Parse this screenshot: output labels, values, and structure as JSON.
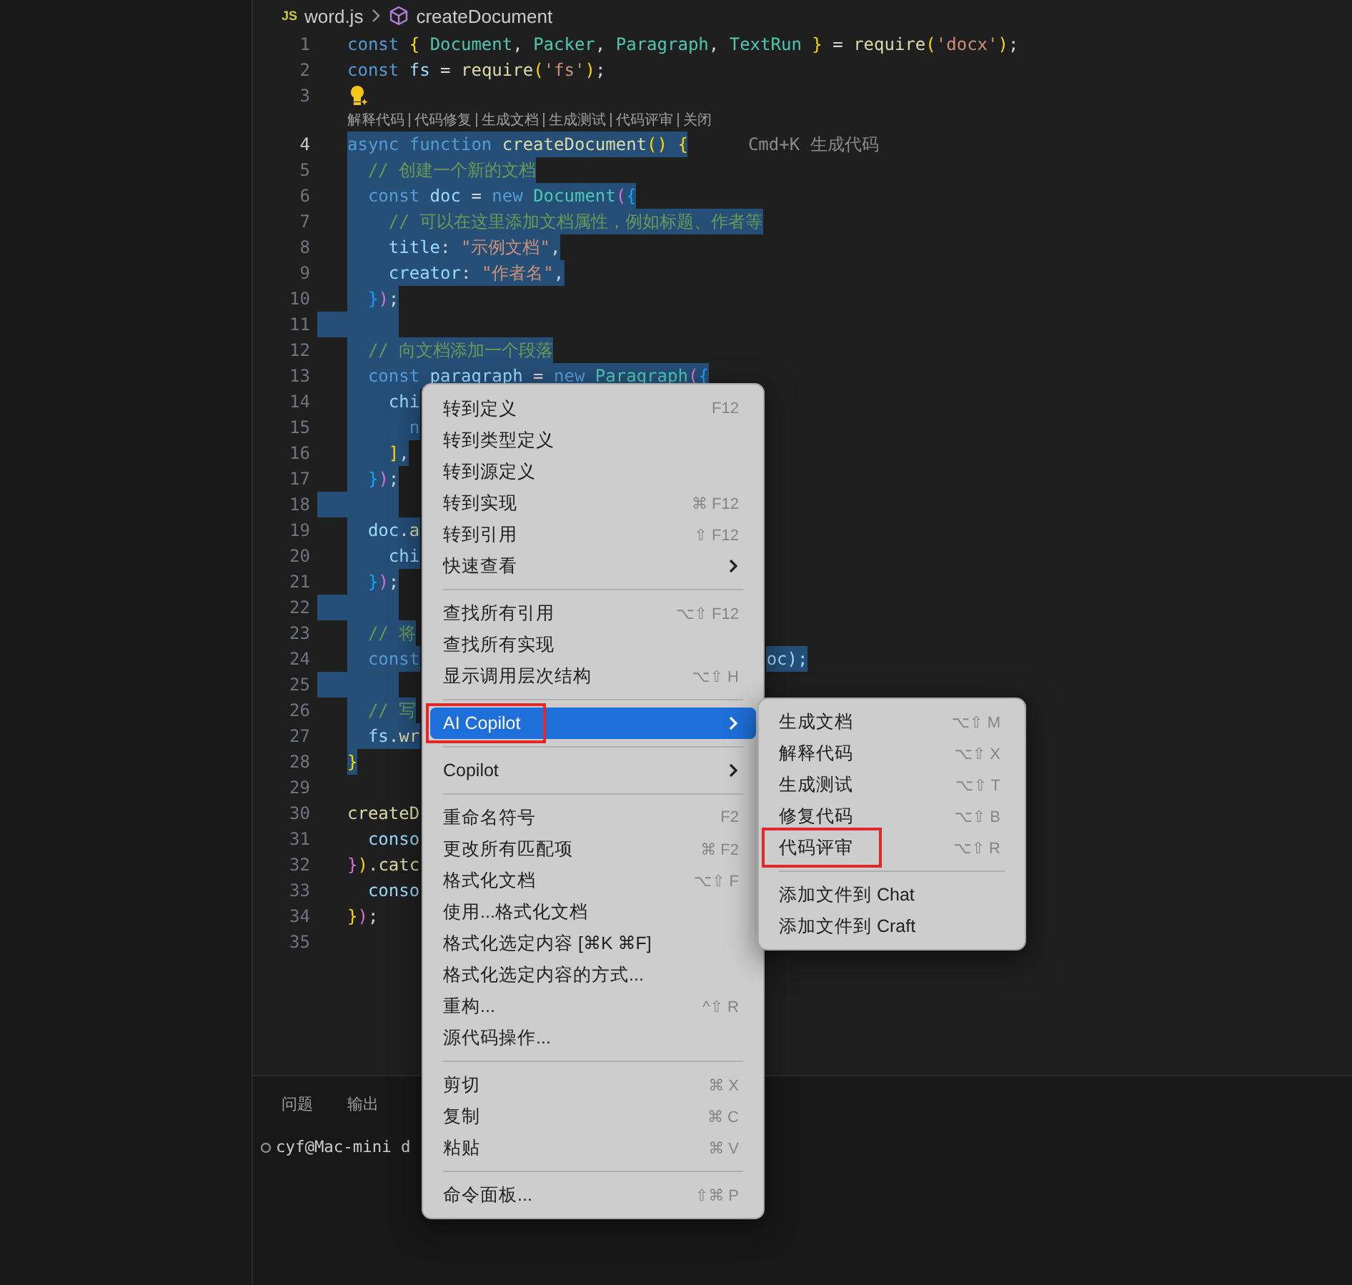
{
  "breadcrumb": {
    "file_badge": "JS",
    "file": "word.js",
    "symbol": "createDocument"
  },
  "codelens": [
    "解释代码",
    "代码修复",
    "生成文档",
    "生成测试",
    "代码评审",
    "关闭"
  ],
  "lines": [
    {
      "n": "1",
      "selected": false,
      "current": false,
      "tokens": [
        {
          "kind": "keyword",
          "text": "const "
        },
        {
          "kind": "bracket1",
          "text": "{ "
        },
        {
          "kind": "class",
          "text": "Document"
        },
        {
          "kind": "punct",
          "text": ", "
        },
        {
          "kind": "class",
          "text": "Packer"
        },
        {
          "kind": "punct",
          "text": ", "
        },
        {
          "kind": "class",
          "text": "Paragraph"
        },
        {
          "kind": "punct",
          "text": ", "
        },
        {
          "kind": "class",
          "text": "TextRun "
        },
        {
          "kind": "bracket1",
          "text": "}"
        },
        {
          "kind": "punct",
          "text": " = "
        },
        {
          "kind": "function",
          "text": "require"
        },
        {
          "kind": "bracket1",
          "text": "("
        },
        {
          "kind": "string",
          "text": "'docx'"
        },
        {
          "kind": "bracket1",
          "text": ")"
        },
        {
          "kind": "punct",
          "text": ";"
        }
      ]
    },
    {
      "n": "2",
      "selected": false,
      "current": false,
      "tokens": [
        {
          "kind": "keyword",
          "text": "const "
        },
        {
          "kind": "variable",
          "text": "fs"
        },
        {
          "kind": "punct",
          "text": " = "
        },
        {
          "kind": "function",
          "text": "require"
        },
        {
          "kind": "bracket1",
          "text": "("
        },
        {
          "kind": "string",
          "text": "'fs'"
        },
        {
          "kind": "bracket1",
          "text": ")"
        },
        {
          "kind": "punct",
          "text": ";"
        }
      ]
    },
    {
      "n": "3",
      "selected": false,
      "current": false,
      "lightbulb": true
    },
    {
      "n": "4",
      "selected": true,
      "current": true,
      "hint": "Cmd+K 生成代码",
      "tokens": [
        {
          "kind": "keyword",
          "text": "async function "
        },
        {
          "kind": "function",
          "text": "createDocument"
        },
        {
          "kind": "bracket1",
          "text": "() {"
        }
      ]
    },
    {
      "n": "5",
      "selected": true,
      "current": false,
      "tokens": [
        {
          "kind": "comment",
          "text": "  // 创建一个新的文档"
        }
      ]
    },
    {
      "n": "6",
      "selected": true,
      "current": false,
      "tokens": [
        {
          "kind": "keyword",
          "text": "  const "
        },
        {
          "kind": "variable",
          "text": "doc"
        },
        {
          "kind": "punct",
          "text": " = "
        },
        {
          "kind": "keyword",
          "text": "new "
        },
        {
          "kind": "class",
          "text": "Document"
        },
        {
          "kind": "bracket2",
          "text": "("
        },
        {
          "kind": "bracket3",
          "text": "{"
        }
      ]
    },
    {
      "n": "7",
      "selected": true,
      "current": false,
      "tokens": [
        {
          "kind": "comment",
          "text": "    // 可以在这里添加文档属性，例如标题、作者等"
        }
      ]
    },
    {
      "n": "8",
      "selected": true,
      "current": false,
      "tokens": [
        {
          "kind": "variable",
          "text": "    title"
        },
        {
          "kind": "punct",
          "text": ": "
        },
        {
          "kind": "string",
          "text": "\"示例文档\""
        },
        {
          "kind": "punct",
          "text": ","
        }
      ]
    },
    {
      "n": "9",
      "selected": true,
      "current": false,
      "tokens": [
        {
          "kind": "variable",
          "text": "    creator"
        },
        {
          "kind": "punct",
          "text": ": "
        },
        {
          "kind": "string",
          "text": "\"作者名\""
        },
        {
          "kind": "punct",
          "text": ","
        }
      ]
    },
    {
      "n": "10",
      "selected": true,
      "current": false,
      "tokens": [
        {
          "kind": "bracket3",
          "text": "  }"
        },
        {
          "kind": "bracket2",
          "text": ")"
        },
        {
          "kind": "punct",
          "text": ";"
        }
      ]
    },
    {
      "n": "11",
      "selected": true,
      "current": false
    },
    {
      "n": "12",
      "selected": true,
      "current": false,
      "tokens": [
        {
          "kind": "comment",
          "text": "  // 向文档添加一个段落"
        }
      ]
    },
    {
      "n": "13",
      "selected": true,
      "current": false,
      "tokens": [
        {
          "kind": "keyword",
          "text": "  const "
        },
        {
          "kind": "variable",
          "text": "paragraph"
        },
        {
          "kind": "punct",
          "text": " = "
        },
        {
          "kind": "keyword",
          "text": "new "
        },
        {
          "kind": "class",
          "text": "Paragraph"
        },
        {
          "kind": "bracket2",
          "text": "("
        },
        {
          "kind": "bracket3",
          "text": "{"
        }
      ]
    },
    {
      "n": "14",
      "selected": true,
      "current": false,
      "tokens": [
        {
          "kind": "variable",
          "text": "    chi"
        }
      ]
    },
    {
      "n": "15",
      "selected": true,
      "current": false,
      "tokens": [
        {
          "kind": "keyword",
          "text": "      n"
        }
      ]
    },
    {
      "n": "16",
      "selected": true,
      "current": false,
      "tokens": [
        {
          "kind": "bracket1",
          "text": "    ]"
        },
        {
          "kind": "punct",
          "text": ","
        }
      ]
    },
    {
      "n": "17",
      "selected": true,
      "current": false,
      "tokens": [
        {
          "kind": "bracket3",
          "text": "  }"
        },
        {
          "kind": "bracket2",
          "text": ")"
        },
        {
          "kind": "punct",
          "text": ";"
        }
      ]
    },
    {
      "n": "18",
      "selected": true,
      "current": false
    },
    {
      "n": "19",
      "selected": true,
      "current": false,
      "tokens": [
        {
          "kind": "variable",
          "text": "  doc"
        },
        {
          "kind": "punct",
          "text": "."
        },
        {
          "kind": "function",
          "text": "a"
        }
      ]
    },
    {
      "n": "20",
      "selected": true,
      "current": false,
      "tokens": [
        {
          "kind": "variable",
          "text": "    chi"
        }
      ]
    },
    {
      "n": "21",
      "selected": true,
      "current": false,
      "tokens": [
        {
          "kind": "bracket3",
          "text": "  }"
        },
        {
          "kind": "bracket2",
          "text": ")"
        },
        {
          "kind": "punct",
          "text": ";"
        }
      ]
    },
    {
      "n": "22",
      "selected": true,
      "current": false
    },
    {
      "n": "23",
      "selected": true,
      "current": false,
      "tokens": [
        {
          "kind": "comment",
          "text": "  // 将"
        }
      ]
    },
    {
      "n": "24",
      "selected": true,
      "current": false,
      "tail": "oc);",
      "tokens": [
        {
          "kind": "keyword",
          "text": "  const"
        }
      ]
    },
    {
      "n": "25",
      "selected": true,
      "current": false
    },
    {
      "n": "26",
      "selected": true,
      "current": false,
      "tokens": [
        {
          "kind": "comment",
          "text": "  // 写"
        }
      ]
    },
    {
      "n": "27",
      "selected": true,
      "current": false,
      "tokens": [
        {
          "kind": "variable",
          "text": "  fs"
        },
        {
          "kind": "punct",
          "text": "."
        },
        {
          "kind": "function",
          "text": "wr"
        }
      ]
    },
    {
      "n": "28",
      "selected": true,
      "current": false,
      "tokens": [
        {
          "kind": "bracket1",
          "text": "}"
        }
      ]
    },
    {
      "n": "29",
      "selected": false,
      "current": false
    },
    {
      "n": "30",
      "selected": false,
      "current": false,
      "tokens": [
        {
          "kind": "function",
          "text": "createD"
        }
      ]
    },
    {
      "n": "31",
      "selected": false,
      "current": false,
      "tokens": [
        {
          "kind": "variable",
          "text": "  conso"
        }
      ]
    },
    {
      "n": "32",
      "selected": false,
      "current": false,
      "tokens": [
        {
          "kind": "bracket2",
          "text": "}"
        },
        {
          "kind": "bracket1",
          "text": ")"
        },
        {
          "kind": "punct",
          "text": "."
        },
        {
          "kind": "function",
          "text": "catc"
        }
      ]
    },
    {
      "n": "33",
      "selected": false,
      "current": false,
      "tokens": [
        {
          "kind": "variable",
          "text": "  conso"
        }
      ]
    },
    {
      "n": "34",
      "selected": false,
      "current": false,
      "tokens": [
        {
          "kind": "bracket1",
          "text": "}"
        },
        {
          "kind": "bracket2",
          "text": ")"
        },
        {
          "kind": "punct",
          "text": ";"
        }
      ]
    },
    {
      "n": "35",
      "selected": false,
      "current": false
    }
  ],
  "panel": {
    "tabs": [
      "问题",
      "输出"
    ],
    "terminal_line": "cyf@Mac-mini d"
  },
  "context_menu": [
    {
      "kind": "item",
      "label": "转到定义",
      "shortcut": "F12",
      "submenu": false,
      "selected": false,
      "annotated": false
    },
    {
      "kind": "item",
      "label": "转到类型定义",
      "submenu": false,
      "selected": false,
      "annotated": false
    },
    {
      "kind": "item",
      "label": "转到源定义",
      "submenu": false,
      "selected": false,
      "annotated": false
    },
    {
      "kind": "item",
      "label": "转到实现",
      "shortcut": "⌘ F12",
      "submenu": false,
      "selected": false,
      "annotated": false
    },
    {
      "kind": "item",
      "label": "转到引用",
      "shortcut": "⇧ F12",
      "submenu": false,
      "selected": false,
      "annotated": false
    },
    {
      "kind": "item",
      "label": "快速查看",
      "submenu": true,
      "selected": false,
      "annotated": false
    },
    {
      "kind": "separator"
    },
    {
      "kind": "item",
      "label": "查找所有引用",
      "shortcut": "⌥⇧ F12",
      "submenu": false,
      "selected": false,
      "annotated": false
    },
    {
      "kind": "item",
      "label": "查找所有实现",
      "submenu": false,
      "selected": false,
      "annotated": false
    },
    {
      "kind": "item",
      "label": "显示调用层次结构",
      "shortcut": "⌥⇧ H",
      "submenu": false,
      "selected": false,
      "annotated": false
    },
    {
      "kind": "separator"
    },
    {
      "kind": "item",
      "label": "AI Copilot",
      "submenu": true,
      "selected": true,
      "annotated": true
    },
    {
      "kind": "separator"
    },
    {
      "kind": "item",
      "label": "Copilot",
      "submenu": true,
      "selected": false,
      "annotated": false
    },
    {
      "kind": "separator"
    },
    {
      "kind": "item",
      "label": "重命名符号",
      "shortcut": "F2",
      "submenu": false,
      "selected": false,
      "annotated": false
    },
    {
      "kind": "item",
      "label": "更改所有匹配项",
      "shortcut": "⌘ F2",
      "submenu": false,
      "selected": false,
      "annotated": false
    },
    {
      "kind": "item",
      "label": "格式化文档",
      "shortcut": "⌥⇧ F",
      "submenu": false,
      "selected": false,
      "annotated": false
    },
    {
      "kind": "item",
      "label": "使用...格式化文档",
      "submenu": false,
      "selected": false,
      "annotated": false
    },
    {
      "kind": "item",
      "label": "格式化选定内容 [⌘K ⌘F]",
      "submenu": false,
      "selected": false,
      "annotated": false
    },
    {
      "kind": "item",
      "label": "格式化选定内容的方式...",
      "submenu": false,
      "selected": false,
      "annotated": false
    },
    {
      "kind": "item",
      "label": "重构...",
      "shortcut": "^⇧ R",
      "submenu": false,
      "selected": false,
      "annotated": false
    },
    {
      "kind": "item",
      "label": "源代码操作...",
      "submenu": false,
      "selected": false,
      "annotated": false
    },
    {
      "kind": "separator"
    },
    {
      "kind": "item",
      "label": "剪切",
      "shortcut": "⌘ X",
      "submenu": false,
      "selected": false,
      "annotated": false
    },
    {
      "kind": "item",
      "label": "复制",
      "shortcut": "⌘ C",
      "submenu": false,
      "selected": false,
      "annotated": false
    },
    {
      "kind": "item",
      "label": "粘贴",
      "shortcut": "⌘ V",
      "submenu": false,
      "selected": false,
      "annotated": false
    },
    {
      "kind": "separator"
    },
    {
      "kind": "item",
      "label": "命令面板...",
      "shortcut": "⇧⌘ P",
      "submenu": false,
      "selected": false,
      "annotated": false
    }
  ],
  "submenu": [
    {
      "kind": "item",
      "label": "生成文档",
      "shortcut": "⌥⇧ M",
      "annotated": false
    },
    {
      "kind": "item",
      "label": "解释代码",
      "shortcut": "⌥⇧ X",
      "annotated": false
    },
    {
      "kind": "item",
      "label": "生成测试",
      "shortcut": "⌥⇧ T",
      "annotated": false
    },
    {
      "kind": "item",
      "label": "修复代码",
      "shortcut": "⌥⇧ B",
      "annotated": false
    },
    {
      "kind": "item",
      "label": "代码评审",
      "shortcut": "⌥⇧ R",
      "annotated": true
    },
    {
      "kind": "separator"
    },
    {
      "kind": "item",
      "label": "添加文件到 Chat",
      "annotated": false
    },
    {
      "kind": "item",
      "label": "添加文件到 Craft",
      "annotated": false
    }
  ]
}
